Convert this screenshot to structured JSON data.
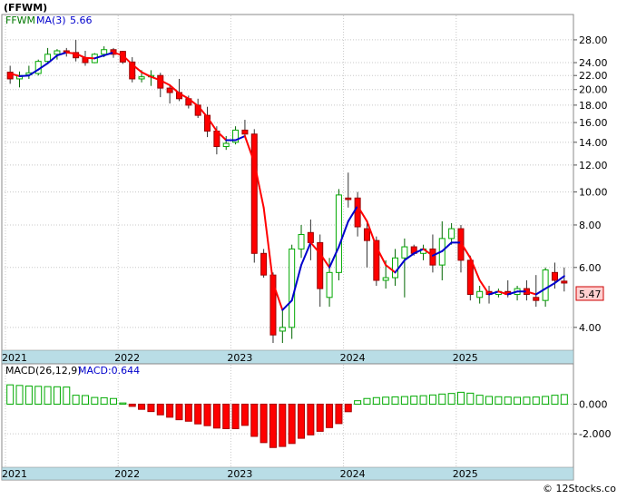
{
  "title": "(FFWM)",
  "watermark": "© 12Stocks.com",
  "price_panel": {
    "legend": {
      "symbol": "FFWM",
      "ma_label": "MA(3)",
      "ma_value": "5.66"
    },
    "last_price_label": "5.47",
    "scale": "log",
    "ylim": [
      3.6,
      30.5
    ],
    "y_ticks": [
      "28.00",
      "24.00",
      "22.00",
      "20.00",
      "18.00",
      "16.00",
      "14.00",
      "12.00",
      "10.00",
      "8.00",
      "6.00",
      "4.00"
    ],
    "colors": {
      "up": "#00aa00",
      "down": "#ff0000",
      "ma": "#0000cc",
      "ma_down": "#ff0000",
      "axis_band": "#b9dde6"
    }
  },
  "macd_panel": {
    "legend": {
      "name": "MACD(26,12,9)",
      "value_label": "MACD:0.644"
    },
    "ylim": [
      -3700,
      1800
    ],
    "y_ticks": [
      "0.000",
      "-2.000"
    ],
    "colors": {
      "positive": "#00aa00",
      "negative": "#ff0000"
    }
  },
  "x_axis": {
    "labels": [
      "2021",
      "2022",
      "2023",
      "2024",
      "2025"
    ]
  },
  "chart_data": {
    "type": "candlestick",
    "interval": "monthly",
    "start": "2021-01",
    "x_labels": [
      "2021",
      "2022",
      "2023",
      "2024",
      "2025"
    ],
    "candles": [
      [
        22.5,
        23.5,
        20.8,
        21.5
      ],
      [
        21.5,
        22.6,
        20.3,
        22.0
      ],
      [
        22.1,
        23.5,
        21.5,
        22.4
      ],
      [
        22.3,
        24.5,
        22.0,
        24.2
      ],
      [
        24.2,
        26.5,
        24.0,
        25.4
      ],
      [
        25.4,
        26.3,
        24.5,
        26.0
      ],
      [
        26.0,
        26.5,
        25.0,
        25.7
      ],
      [
        25.7,
        28.0,
        24.2,
        24.8
      ],
      [
        24.8,
        26.0,
        23.5,
        24.0
      ],
      [
        24.0,
        25.6,
        23.9,
        25.4
      ],
      [
        25.4,
        26.8,
        24.9,
        26.2
      ],
      [
        26.2,
        26.5,
        24.8,
        25.4
      ],
      [
        25.9,
        26.0,
        23.8,
        24.1
      ],
      [
        24.1,
        24.9,
        21.0,
        21.5
      ],
      [
        21.5,
        22.8,
        21.0,
        21.8
      ],
      [
        21.8,
        22.8,
        20.5,
        22.0
      ],
      [
        22.0,
        22.4,
        19.0,
        20.2
      ],
      [
        20.2,
        20.6,
        18.2,
        19.6
      ],
      [
        19.6,
        21.5,
        18.5,
        18.8
      ],
      [
        18.8,
        19.2,
        17.6,
        18.0
      ],
      [
        18.0,
        18.8,
        16.5,
        16.8
      ],
      [
        16.8,
        17.8,
        14.5,
        15.1
      ],
      [
        15.1,
        15.6,
        12.9,
        13.6
      ],
      [
        13.6,
        14.6,
        13.3,
        13.9
      ],
      [
        14.0,
        15.6,
        13.8,
        15.2
      ],
      [
        15.2,
        16.3,
        14.5,
        14.8
      ],
      [
        14.8,
        15.3,
        6.2,
        6.6
      ],
      [
        6.6,
        6.8,
        5.6,
        5.7
      ],
      [
        5.7,
        5.8,
        3.6,
        3.8
      ],
      [
        3.9,
        4.5,
        3.6,
        4.0
      ],
      [
        4.0,
        7.0,
        3.7,
        6.8
      ],
      [
        6.8,
        8.0,
        6.4,
        7.5
      ],
      [
        7.6,
        8.3,
        6.3,
        7.1
      ],
      [
        7.1,
        7.5,
        4.6,
        5.2
      ],
      [
        4.9,
        6.4,
        4.6,
        5.8
      ],
      [
        5.8,
        10.2,
        5.5,
        9.8
      ],
      [
        9.6,
        11.4,
        9.0,
        9.5
      ],
      [
        9.6,
        10.0,
        7.4,
        7.9
      ],
      [
        7.8,
        8.1,
        6.0,
        7.2
      ],
      [
        7.2,
        7.4,
        5.3,
        5.5
      ],
      [
        5.5,
        6.3,
        5.2,
        5.6
      ],
      [
        5.6,
        6.8,
        5.3,
        6.4
      ],
      [
        6.4,
        7.3,
        4.9,
        6.9
      ],
      [
        6.9,
        7.0,
        6.5,
        6.6
      ],
      [
        6.6,
        7.0,
        6.3,
        6.8
      ],
      [
        6.8,
        7.5,
        5.8,
        6.1
      ],
      [
        6.1,
        8.2,
        5.5,
        7.3
      ],
      [
        7.3,
        8.1,
        7.0,
        7.8
      ],
      [
        7.8,
        8.0,
        5.8,
        6.3
      ],
      [
        6.3,
        6.5,
        4.8,
        5.0
      ],
      [
        4.9,
        5.3,
        4.7,
        5.1
      ],
      [
        5.1,
        5.3,
        4.7,
        5.0
      ],
      [
        5.0,
        5.2,
        4.9,
        5.1
      ],
      [
        5.1,
        5.5,
        4.9,
        5.0
      ],
      [
        5.0,
        5.3,
        4.8,
        5.2
      ],
      [
        5.2,
        5.5,
        4.8,
        5.0
      ],
      [
        4.9,
        5.7,
        4.6,
        4.8
      ],
      [
        4.8,
        6.0,
        4.6,
        5.9
      ],
      [
        5.8,
        6.2,
        5.2,
        5.5
      ],
      [
        5.47,
        6.0,
        5.1,
        5.4
      ]
    ],
    "ma": [
      22.3,
      21.9,
      22.0,
      22.9,
      23.9,
      25.2,
      25.7,
      25.5,
      24.8,
      24.7,
      25.2,
      25.7,
      25.2,
      23.7,
      22.5,
      21.8,
      21.3,
      20.6,
      19.5,
      18.8,
      17.9,
      16.6,
      15.1,
      14.2,
      14.2,
      14.6,
      12.2,
      9.0,
      5.4,
      4.5,
      4.8,
      6.1,
      7.1,
      6.6,
      6.0,
      6.9,
      8.2,
      9.1,
      8.2,
      6.9,
      6.1,
      5.8,
      6.3,
      6.6,
      6.8,
      6.5,
      6.7,
      7.1,
      7.1,
      6.4,
      5.5,
      5.0,
      5.1,
      5.0,
      5.1,
      5.1,
      5.0,
      5.2,
      5.4,
      5.66
    ],
    "macd": [
      1300,
      1260,
      1220,
      1200,
      1180,
      1170,
      1150,
      600,
      580,
      450,
      430,
      380,
      80,
      -150,
      -350,
      -500,
      -720,
      -880,
      -1050,
      -1150,
      -1330,
      -1450,
      -1610,
      -1650,
      -1650,
      -1430,
      -2170,
      -2590,
      -2920,
      -2850,
      -2650,
      -2300,
      -2070,
      -1830,
      -1580,
      -1310,
      -510,
      230,
      380,
      440,
      470,
      490,
      510,
      540,
      570,
      620,
      680,
      720,
      800,
      740,
      600,
      520,
      500,
      480,
      460,
      470,
      480,
      520,
      600,
      644
    ],
    "series": [
      {
        "name": "FFWM"
      },
      {
        "name": "MA(3)"
      },
      {
        "name": "MACD(26,12,9)"
      }
    ]
  }
}
